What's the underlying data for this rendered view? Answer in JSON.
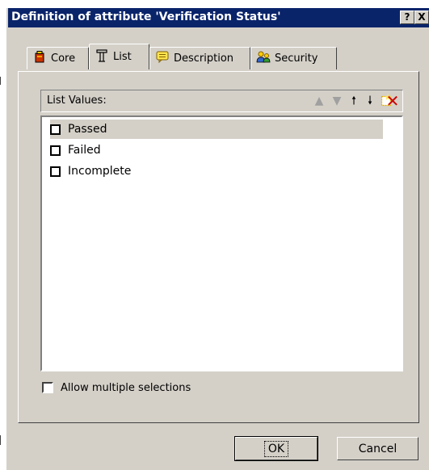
{
  "window": {
    "title": "Definition of attribute 'Verification Status'",
    "help_btn": "?",
    "close_btn": "X"
  },
  "tabs": [
    {
      "label": "Core",
      "icon": "core-icon",
      "active": false
    },
    {
      "label": "List",
      "icon": "list-icon",
      "active": true
    },
    {
      "label": "Description",
      "icon": "description-icon",
      "active": false
    },
    {
      "label": "Security",
      "icon": "security-icon",
      "active": false
    }
  ],
  "list": {
    "header": "List Values:",
    "items": [
      {
        "label": "Passed",
        "checked": false,
        "selected": true
      },
      {
        "label": "Failed",
        "checked": false,
        "selected": false
      },
      {
        "label": "Incomplete",
        "checked": false,
        "selected": false
      }
    ]
  },
  "allow_multiple": {
    "label": "Allow multiple selections",
    "checked": false
  },
  "buttons": {
    "ok": "OK",
    "cancel": "Cancel"
  },
  "colors": {
    "titlebar": "#0a246a",
    "dialog": "#d4d0c8",
    "delete_red": "#cc0000",
    "note_yellow": "#ffe34d"
  }
}
